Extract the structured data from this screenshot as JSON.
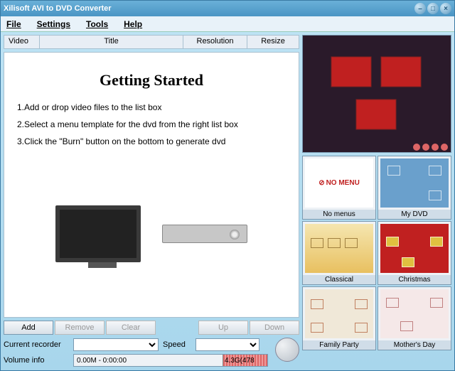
{
  "window": {
    "title": "Xilisoft AVI to DVD Converter"
  },
  "menubar": [
    "File",
    "Settings",
    "Tools",
    "Help"
  ],
  "list": {
    "columns": [
      "Video",
      "Title",
      "Resolution",
      "Resize"
    ]
  },
  "getting_started": {
    "title": "Getting Started",
    "steps": [
      "1.Add or drop video files to the list box",
      "2.Select a menu template for the dvd from the right list box",
      "3.Click the \"Burn\" button on the bottom to generate dvd"
    ]
  },
  "actions": {
    "add": "Add",
    "remove": "Remove",
    "clear": "Clear",
    "up": "Up",
    "down": "Down"
  },
  "recorder": {
    "label": "Current recorder",
    "speed_label": "Speed"
  },
  "volume": {
    "label": "Volume info",
    "text": "0.00M - 0:00:00",
    "free": "4.3G(478"
  },
  "templates": [
    {
      "name": "No menus"
    },
    {
      "name": "My DVD"
    },
    {
      "name": "Classical"
    },
    {
      "name": "Christmas"
    },
    {
      "name": "Family Party"
    },
    {
      "name": "Mother's Day"
    }
  ]
}
